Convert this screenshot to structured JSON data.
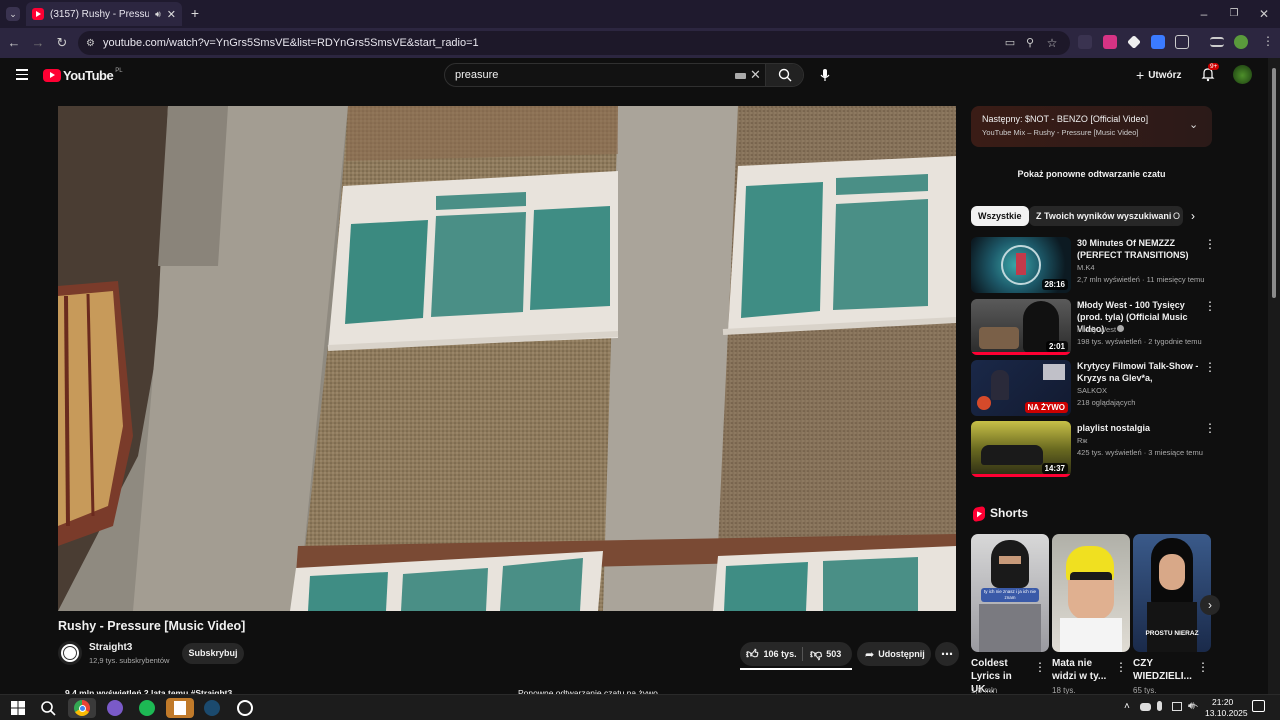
{
  "browser": {
    "tab_title": "(3157) Rushy - Pressure [Mu",
    "url": "youtube.com/watch?v=YnGrs5SmsVE&list=RDYnGrs5SmsVE&start_radio=1"
  },
  "header": {
    "logo_text": "YouTube",
    "logo_region": "PL",
    "search_value": "preasure",
    "create_label": "Utwórz",
    "notif_badge": "9+"
  },
  "video": {
    "title": "Rushy - Pressure [Music Video]",
    "channel": "Straight3",
    "subscribers": "12,9 tys. subskrybentów",
    "subscribe_label": "Subskrybuj",
    "likes": "106 tys.",
    "dislikes": "503",
    "share_label": "Udostępnij",
    "stats": "9,4 mln wyświetleń  2 lata temu  #Straight3",
    "chat_replay_bottom": "Ponowne odtwarzanie czatu na żywo"
  },
  "sidebar": {
    "next_label": "Następny: $NOT - BENZO [Official Video]",
    "next_sub": "YouTube Mix – Rushy - Pressure [Music Video]",
    "chat_replay": "Pokaż ponowne odtwarzanie czatu",
    "chips": [
      "Wszystkie",
      "Z Twoich wyników wyszukiwania",
      "O"
    ],
    "recs": [
      {
        "title": "30 Minutes Of NEMZZZ (PERFECT TRANSITIONS)",
        "channel": "M.K4",
        "meta": "2,7 mln wyświetleń · 11 miesięcy temu",
        "duration": "28:16"
      },
      {
        "title": "Młody West - 100 Tysięcy (prod. tyla) (Official Music Video)",
        "channel": "Młody West",
        "meta": "198 tys. wyświetleń · 2 tygodnie temu",
        "duration": "2:01"
      },
      {
        "title": "Krytycy Filmowi Talk-Show - Kryzys na Glev*a, kopiowanie ...",
        "channel": "SALKOX",
        "meta": "218 oglądających",
        "duration": "NA ŻYWO"
      },
      {
        "title": "playlist nostalgia",
        "channel": "Rж",
        "meta": "425 tys. wyświetleń · 3 miesiące temu",
        "duration": "14:37"
      }
    ],
    "shorts_label": "Shorts",
    "shorts": [
      {
        "title": "Coldest Lyrics in UK...",
        "meta": "1,8 mln",
        "caption": "ty ich nie znasz i ja ich nie znam"
      },
      {
        "title": "Mata nie widzi w ty...",
        "meta": "18 tys."
      },
      {
        "title": "CZY WIEDZIELI...",
        "meta": "65 tys.",
        "caption": "PROSTU NIERAZ"
      }
    ]
  },
  "taskbar": {
    "time": "21:20",
    "date": "13.10.2025"
  },
  "colors": {
    "accent": "#ff0033",
    "page_bg": "#0f0f0f",
    "chrome_bg": "#2c2640"
  }
}
